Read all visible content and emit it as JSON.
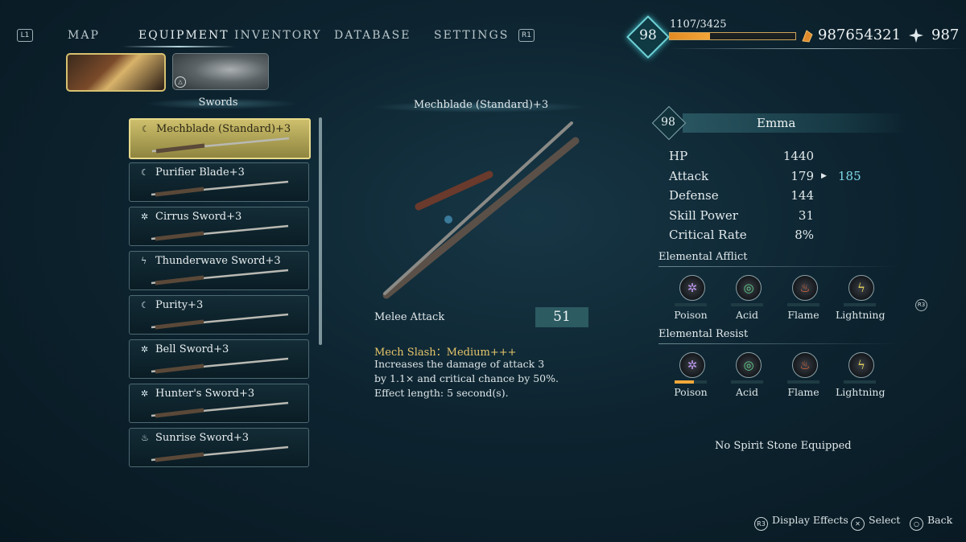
{
  "nav": {
    "left_hint": "L1",
    "right_hint": "R1",
    "tabs": [
      "MAP",
      "EQUIPMENT",
      "INVENTORY",
      "DATABASE",
      "SETTINGS"
    ],
    "active_tab": "EQUIPMENT"
  },
  "player": {
    "level": "98",
    "xp": "1107/3425",
    "xp_fraction": 0.323,
    "currency_gold": "987654321",
    "currency_spirit": "987"
  },
  "characters": {
    "switch_hint": "△"
  },
  "list": {
    "category": "Swords",
    "items": [
      {
        "name": "Mechblade (Standard)+3",
        "icon": "wind-icon",
        "glyph": "☾"
      },
      {
        "name": "Purifier Blade+3",
        "icon": "wind-icon",
        "glyph": "☾"
      },
      {
        "name": "Cirrus Sword+3",
        "icon": "poison-icon",
        "glyph": "✲"
      },
      {
        "name": "Thunderwave Sword+3",
        "icon": "lightning-icon",
        "glyph": "ϟ"
      },
      {
        "name": "Purity+3",
        "icon": "wind-icon",
        "glyph": "☾"
      },
      {
        "name": "Bell Sword+3",
        "icon": "poison-icon",
        "glyph": "✲"
      },
      {
        "name": "Hunter's Sword+3",
        "icon": "poison-icon",
        "glyph": "✲"
      },
      {
        "name": "Sunrise Sword+3",
        "icon": "flame-icon",
        "glyph": "♨"
      }
    ],
    "selected_index": 0
  },
  "detail": {
    "weapon_name": "Mechblade (Standard)+3",
    "melee_label": "Melee Attack",
    "melee_value": "51",
    "effect_title": "Mech Slash：Medium+++",
    "effect_lines": [
      "Increases the damage of attack 3",
      "by 1.1× and critical chance by 50%.",
      "Effect length: 5 second(s)."
    ]
  },
  "character": {
    "level": "98",
    "name": "Emma",
    "stats": [
      {
        "label": "HP",
        "value": "1440",
        "new": ""
      },
      {
        "label": "Attack",
        "value": "179",
        "new": "185"
      },
      {
        "label": "Defense",
        "value": "144",
        "new": ""
      },
      {
        "label": "Skill Power",
        "value": "31",
        "new": ""
      },
      {
        "label": "Critical Rate",
        "value": "8%",
        "new": ""
      }
    ],
    "afflict_title": "Elemental Afflict",
    "resist_title": "Elemental Resist",
    "elements": [
      {
        "label": "Poison",
        "icon": "poison-icon",
        "glyph": "✲",
        "color": "#b892e8"
      },
      {
        "label": "Acid",
        "icon": "acid-icon",
        "glyph": "◎",
        "color": "#5fd08a"
      },
      {
        "label": "Flame",
        "icon": "flame-icon",
        "glyph": "♨",
        "color": "#f06a3a"
      },
      {
        "label": "Lightning",
        "icon": "lightning-icon",
        "glyph": "ϟ",
        "color": "#e9d85a"
      }
    ],
    "afflict_levels": [
      0,
      0,
      0,
      0
    ],
    "resist_levels": [
      0.6,
      0,
      0,
      0
    ],
    "r3_hint": "R3",
    "spirit_stone": "No Spirit Stone Equipped"
  },
  "footer": {
    "display_effects": "Display Effects",
    "display_hint": "R3",
    "select": "Select",
    "select_hint": "✕",
    "back": "Back",
    "back_hint": "○"
  }
}
